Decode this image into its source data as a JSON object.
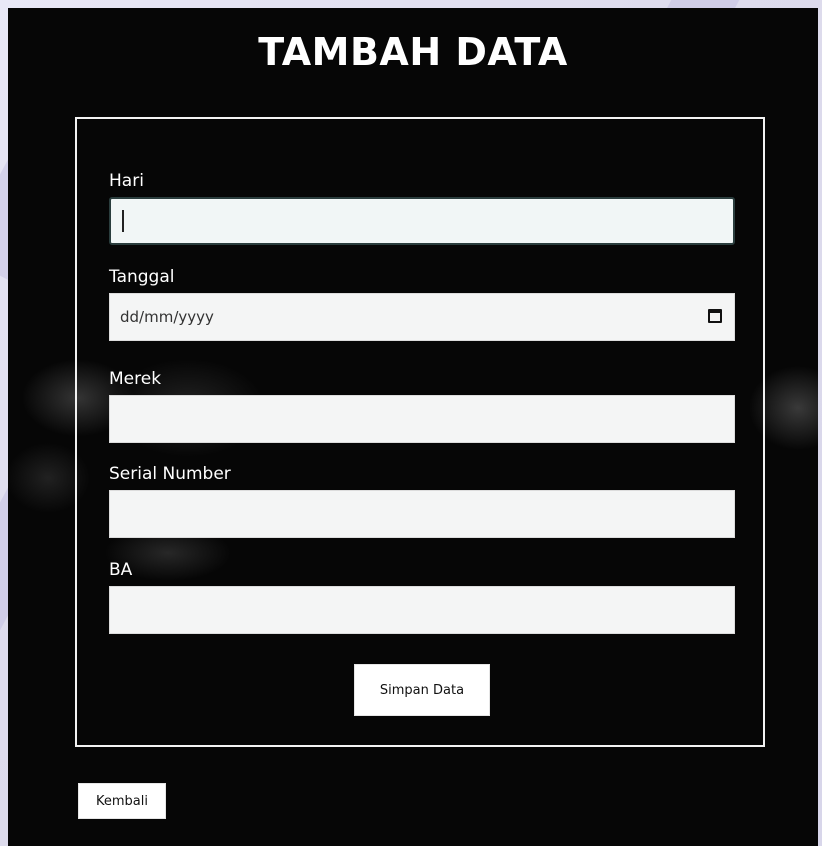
{
  "page": {
    "title": "TAMBAH DATA"
  },
  "form": {
    "fields": [
      {
        "label": "Hari",
        "value": "",
        "type": "text"
      },
      {
        "label": "Tanggal",
        "placeholder": "dd/mm/yyyy",
        "type": "date"
      },
      {
        "label": "Merek",
        "value": "",
        "type": "text"
      },
      {
        "label": "Serial Number",
        "value": "",
        "type": "text"
      },
      {
        "label": "BA",
        "value": "",
        "type": "text"
      }
    ],
    "submit_label": "Simpan Data"
  },
  "nav": {
    "back_label": "Kembali"
  },
  "colors": {
    "panel_background": "#060606",
    "outer_background": "#dedced",
    "text": "#ffffff",
    "input_background": "#f4f5f5"
  },
  "icons": {
    "date_picker": "calendar-icon"
  }
}
